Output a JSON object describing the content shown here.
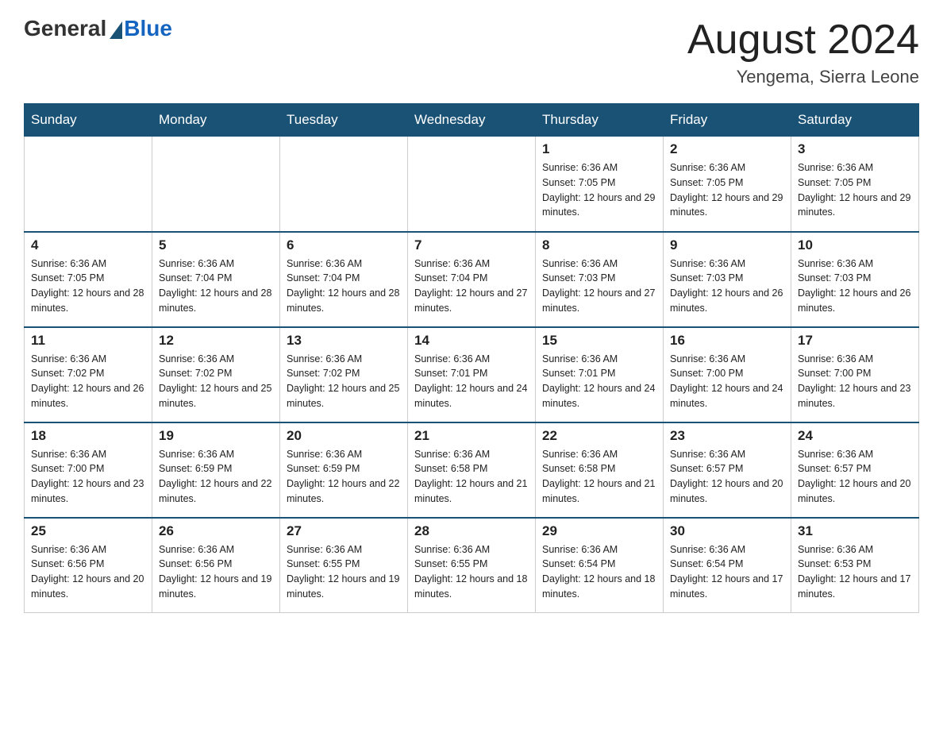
{
  "header": {
    "logo_general": "General",
    "logo_blue": "Blue",
    "month_title": "August 2024",
    "location": "Yengema, Sierra Leone"
  },
  "weekdays": [
    "Sunday",
    "Monday",
    "Tuesday",
    "Wednesday",
    "Thursday",
    "Friday",
    "Saturday"
  ],
  "weeks": [
    [
      {
        "day": "",
        "sunrise": "",
        "sunset": "",
        "daylight": ""
      },
      {
        "day": "",
        "sunrise": "",
        "sunset": "",
        "daylight": ""
      },
      {
        "day": "",
        "sunrise": "",
        "sunset": "",
        "daylight": ""
      },
      {
        "day": "",
        "sunrise": "",
        "sunset": "",
        "daylight": ""
      },
      {
        "day": "1",
        "sunrise": "Sunrise: 6:36 AM",
        "sunset": "Sunset: 7:05 PM",
        "daylight": "Daylight: 12 hours and 29 minutes."
      },
      {
        "day": "2",
        "sunrise": "Sunrise: 6:36 AM",
        "sunset": "Sunset: 7:05 PM",
        "daylight": "Daylight: 12 hours and 29 minutes."
      },
      {
        "day": "3",
        "sunrise": "Sunrise: 6:36 AM",
        "sunset": "Sunset: 7:05 PM",
        "daylight": "Daylight: 12 hours and 29 minutes."
      }
    ],
    [
      {
        "day": "4",
        "sunrise": "Sunrise: 6:36 AM",
        "sunset": "Sunset: 7:05 PM",
        "daylight": "Daylight: 12 hours and 28 minutes."
      },
      {
        "day": "5",
        "sunrise": "Sunrise: 6:36 AM",
        "sunset": "Sunset: 7:04 PM",
        "daylight": "Daylight: 12 hours and 28 minutes."
      },
      {
        "day": "6",
        "sunrise": "Sunrise: 6:36 AM",
        "sunset": "Sunset: 7:04 PM",
        "daylight": "Daylight: 12 hours and 28 minutes."
      },
      {
        "day": "7",
        "sunrise": "Sunrise: 6:36 AM",
        "sunset": "Sunset: 7:04 PM",
        "daylight": "Daylight: 12 hours and 27 minutes."
      },
      {
        "day": "8",
        "sunrise": "Sunrise: 6:36 AM",
        "sunset": "Sunset: 7:03 PM",
        "daylight": "Daylight: 12 hours and 27 minutes."
      },
      {
        "day": "9",
        "sunrise": "Sunrise: 6:36 AM",
        "sunset": "Sunset: 7:03 PM",
        "daylight": "Daylight: 12 hours and 26 minutes."
      },
      {
        "day": "10",
        "sunrise": "Sunrise: 6:36 AM",
        "sunset": "Sunset: 7:03 PM",
        "daylight": "Daylight: 12 hours and 26 minutes."
      }
    ],
    [
      {
        "day": "11",
        "sunrise": "Sunrise: 6:36 AM",
        "sunset": "Sunset: 7:02 PM",
        "daylight": "Daylight: 12 hours and 26 minutes."
      },
      {
        "day": "12",
        "sunrise": "Sunrise: 6:36 AM",
        "sunset": "Sunset: 7:02 PM",
        "daylight": "Daylight: 12 hours and 25 minutes."
      },
      {
        "day": "13",
        "sunrise": "Sunrise: 6:36 AM",
        "sunset": "Sunset: 7:02 PM",
        "daylight": "Daylight: 12 hours and 25 minutes."
      },
      {
        "day": "14",
        "sunrise": "Sunrise: 6:36 AM",
        "sunset": "Sunset: 7:01 PM",
        "daylight": "Daylight: 12 hours and 24 minutes."
      },
      {
        "day": "15",
        "sunrise": "Sunrise: 6:36 AM",
        "sunset": "Sunset: 7:01 PM",
        "daylight": "Daylight: 12 hours and 24 minutes."
      },
      {
        "day": "16",
        "sunrise": "Sunrise: 6:36 AM",
        "sunset": "Sunset: 7:00 PM",
        "daylight": "Daylight: 12 hours and 24 minutes."
      },
      {
        "day": "17",
        "sunrise": "Sunrise: 6:36 AM",
        "sunset": "Sunset: 7:00 PM",
        "daylight": "Daylight: 12 hours and 23 minutes."
      }
    ],
    [
      {
        "day": "18",
        "sunrise": "Sunrise: 6:36 AM",
        "sunset": "Sunset: 7:00 PM",
        "daylight": "Daylight: 12 hours and 23 minutes."
      },
      {
        "day": "19",
        "sunrise": "Sunrise: 6:36 AM",
        "sunset": "Sunset: 6:59 PM",
        "daylight": "Daylight: 12 hours and 22 minutes."
      },
      {
        "day": "20",
        "sunrise": "Sunrise: 6:36 AM",
        "sunset": "Sunset: 6:59 PM",
        "daylight": "Daylight: 12 hours and 22 minutes."
      },
      {
        "day": "21",
        "sunrise": "Sunrise: 6:36 AM",
        "sunset": "Sunset: 6:58 PM",
        "daylight": "Daylight: 12 hours and 21 minutes."
      },
      {
        "day": "22",
        "sunrise": "Sunrise: 6:36 AM",
        "sunset": "Sunset: 6:58 PM",
        "daylight": "Daylight: 12 hours and 21 minutes."
      },
      {
        "day": "23",
        "sunrise": "Sunrise: 6:36 AM",
        "sunset": "Sunset: 6:57 PM",
        "daylight": "Daylight: 12 hours and 20 minutes."
      },
      {
        "day": "24",
        "sunrise": "Sunrise: 6:36 AM",
        "sunset": "Sunset: 6:57 PM",
        "daylight": "Daylight: 12 hours and 20 minutes."
      }
    ],
    [
      {
        "day": "25",
        "sunrise": "Sunrise: 6:36 AM",
        "sunset": "Sunset: 6:56 PM",
        "daylight": "Daylight: 12 hours and 20 minutes."
      },
      {
        "day": "26",
        "sunrise": "Sunrise: 6:36 AM",
        "sunset": "Sunset: 6:56 PM",
        "daylight": "Daylight: 12 hours and 19 minutes."
      },
      {
        "day": "27",
        "sunrise": "Sunrise: 6:36 AM",
        "sunset": "Sunset: 6:55 PM",
        "daylight": "Daylight: 12 hours and 19 minutes."
      },
      {
        "day": "28",
        "sunrise": "Sunrise: 6:36 AM",
        "sunset": "Sunset: 6:55 PM",
        "daylight": "Daylight: 12 hours and 18 minutes."
      },
      {
        "day": "29",
        "sunrise": "Sunrise: 6:36 AM",
        "sunset": "Sunset: 6:54 PM",
        "daylight": "Daylight: 12 hours and 18 minutes."
      },
      {
        "day": "30",
        "sunrise": "Sunrise: 6:36 AM",
        "sunset": "Sunset: 6:54 PM",
        "daylight": "Daylight: 12 hours and 17 minutes."
      },
      {
        "day": "31",
        "sunrise": "Sunrise: 6:36 AM",
        "sunset": "Sunset: 6:53 PM",
        "daylight": "Daylight: 12 hours and 17 minutes."
      }
    ]
  ]
}
